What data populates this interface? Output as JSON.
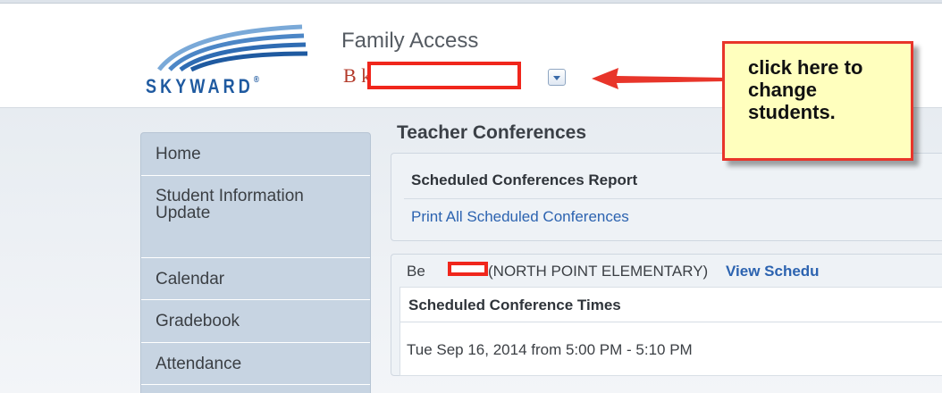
{
  "header": {
    "logo_text": "SKYWARD",
    "app_title": "Family Access",
    "student_name": "B k"
  },
  "callout": {
    "text": "click here to change students."
  },
  "sidebar": {
    "items": [
      {
        "label": "Home"
      },
      {
        "label": "Student Information Update"
      },
      {
        "label": "Calendar"
      },
      {
        "label": "Gradebook"
      },
      {
        "label": "Attendance"
      }
    ]
  },
  "main": {
    "heading": "Teacher Conferences",
    "report_panel": {
      "title": "Scheduled Conferences Report",
      "link": "Print All Scheduled Conferences"
    },
    "student_panel": {
      "student": "Be",
      "school": "(NORTH POINT ELEMENTARY)",
      "link": "View Schedu",
      "section_title": "Scheduled Conference Times",
      "time": "Tue Sep 16, 2014 from 5:00 PM - 5:10 PM"
    }
  },
  "colors": {
    "brand_blue": "#1f5aa0",
    "link_blue": "#2c63b0",
    "redaction_red": "#f0261c",
    "callout_yellow": "#ffffbe",
    "sidebar_bg": "#c7d4e2"
  },
  "icons": {
    "dropdown": "chevron-down-icon",
    "arrow": "arrow-left-icon",
    "logo": "skyward-swoosh-icon"
  }
}
